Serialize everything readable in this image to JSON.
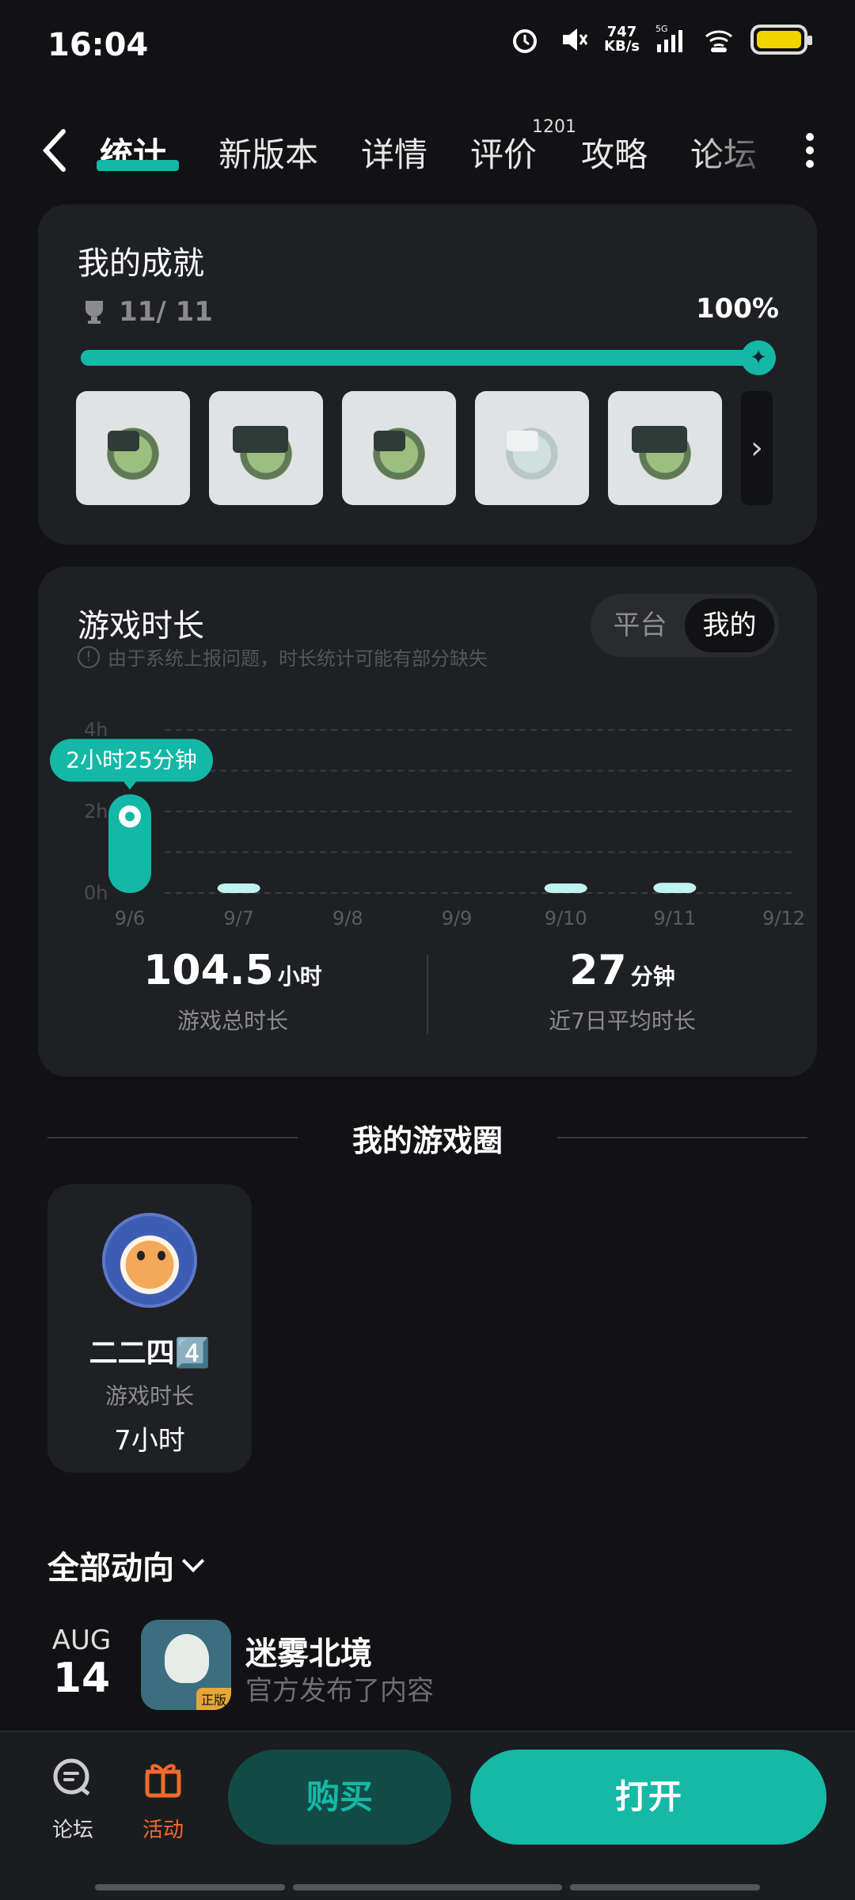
{
  "status_bar": {
    "time": "16:04",
    "net_speed": "747",
    "net_unit": "KB/s",
    "signal": "5G"
  },
  "tabs": [
    {
      "label": "统计"
    },
    {
      "label": "新版本"
    },
    {
      "label": "详情"
    },
    {
      "label": "评价"
    },
    {
      "label": "攻略"
    },
    {
      "label": "论坛"
    }
  ],
  "review_badge": "1201",
  "achievements": {
    "title": "我的成就",
    "count": "11/ 11",
    "percent_text": "100%",
    "progress": 1.0
  },
  "playtime": {
    "title": "游戏时长",
    "notice": "由于系统上报问题，时长统计可能有部分缺失",
    "toggle": [
      "平台",
      "我的"
    ],
    "total_value": "104.5",
    "total_unit": "小时",
    "total_label": "游戏总时长",
    "avg_value": "27",
    "avg_unit": "分钟",
    "avg_label": "近7日平均时长"
  },
  "chart_data": {
    "type": "bar",
    "categories": [
      "9/6",
      "9/7",
      "9/8",
      "9/9",
      "9/10",
      "9/11",
      "9/12"
    ],
    "values": [
      2.42,
      0.12,
      0,
      0,
      0.12,
      0.25,
      0
    ],
    "y_ticks": [
      "0h",
      "2h",
      "4h"
    ],
    "ylim": [
      0,
      4
    ],
    "tooltip": "2小时25分钟",
    "highlight_index": 0,
    "colors": {
      "active": "#13b8a6",
      "inactive": "#bff3f0"
    }
  },
  "circle": {
    "title": "我的游戏圈",
    "friend_name": "二二四4️⃣",
    "friend_label": "游戏时长",
    "friend_value": "7小时"
  },
  "activity": {
    "filter": "全部动向",
    "month": "AUG",
    "day": "14",
    "game_title": "迷雾北境",
    "desc": "官方发布了内容",
    "icon_tag": "正版"
  },
  "bottom": {
    "forum": "论坛",
    "event": "活动",
    "buy": "购买",
    "open": "打开"
  }
}
